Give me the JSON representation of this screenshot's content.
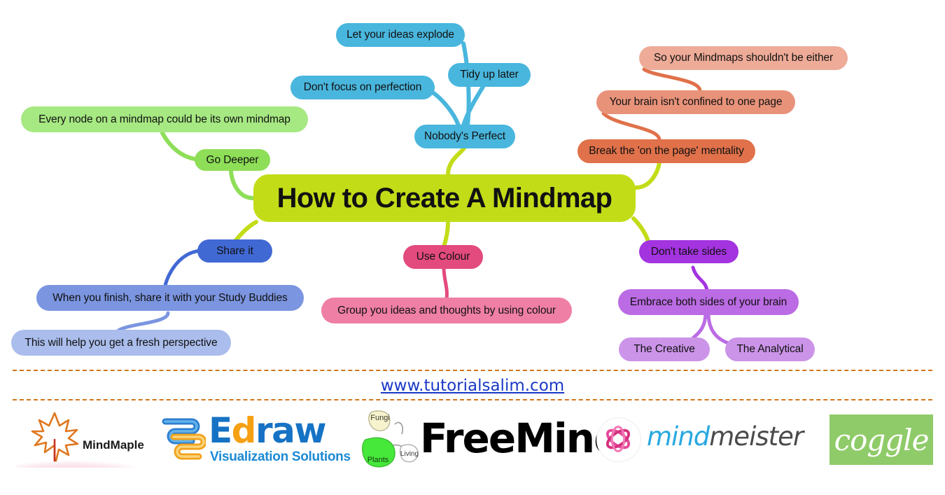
{
  "map": {
    "root": {
      "label": "How to Create A Mindmap",
      "color": "#c3dc18"
    },
    "branches": [
      {
        "name": "go-deeper",
        "color": "#8ede58",
        "nodes": [
          {
            "label": "Go Deeper",
            "color": "#8ede58"
          },
          {
            "label": "Every node on a mindmap could be its own mindmap",
            "color": "#a6e882"
          }
        ]
      },
      {
        "name": "nobodys-perfect",
        "color": "#49b6dd",
        "nodes": [
          {
            "label": "Nobody's Perfect",
            "color": "#49b6dd"
          },
          {
            "label": "Don't focus on perfection",
            "color": "#49b6dd"
          },
          {
            "label": "Tidy up later",
            "color": "#49b6dd"
          },
          {
            "label": "Let your ideas explode",
            "color": "#49b6dd"
          }
        ]
      },
      {
        "name": "break-on-the-page",
        "color": "#e0714a",
        "nodes": [
          {
            "label": "Break the 'on the page' mentality",
            "color": "#e0714a"
          },
          {
            "label": "Your brain isn't confined to one page",
            "color": "#e8927a"
          },
          {
            "label": "So your Mindmaps shouldn't be either",
            "color": "#eeab98"
          }
        ]
      },
      {
        "name": "share-it",
        "color": "#4169d4",
        "nodes": [
          {
            "label": "Share it",
            "color": "#4169d4"
          },
          {
            "label": "When you finish, share it with your Study Buddies",
            "color": "#7b95e0"
          },
          {
            "label": "This will help you get a fresh perspective",
            "color": "#aabdec"
          }
        ]
      },
      {
        "name": "use-colour",
        "color": "#e34a7e",
        "nodes": [
          {
            "label": "Use Colour",
            "color": "#e34a7e"
          },
          {
            "label": "Group you ideas and thoughts by using colour",
            "color": "#ef7fa4"
          }
        ]
      },
      {
        "name": "dont-take-sides",
        "color": "#a433e0",
        "nodes": [
          {
            "label": "Don't take sides",
            "color": "#a433e0"
          },
          {
            "label": "Embrace both sides of your brain",
            "color": "#bb6be4"
          },
          {
            "label": "The Creative",
            "color": "#cb94e8"
          },
          {
            "label": "The Analytical",
            "color": "#cb94e8"
          }
        ]
      }
    ]
  },
  "footer": {
    "url": "www.tutorialsalim.com",
    "url_color": "#1a39c6",
    "divider_color": "#d1761e",
    "logos": [
      {
        "name": "mindmaple",
        "word": "MindMaple"
      },
      {
        "name": "edraw",
        "word_e": "E",
        "word_d": "d",
        "word_raw": "raw",
        "sub": "Visualization Solutions"
      },
      {
        "name": "freemind-node",
        "label_top": "Fungi",
        "label_left": "Plants",
        "label_right": "Living"
      },
      {
        "name": "freemind",
        "word": "FreeMind"
      },
      {
        "name": "mindmeister",
        "word_a": "mind",
        "word_b": "meister"
      },
      {
        "name": "coggle",
        "word": "coggle"
      }
    ]
  }
}
